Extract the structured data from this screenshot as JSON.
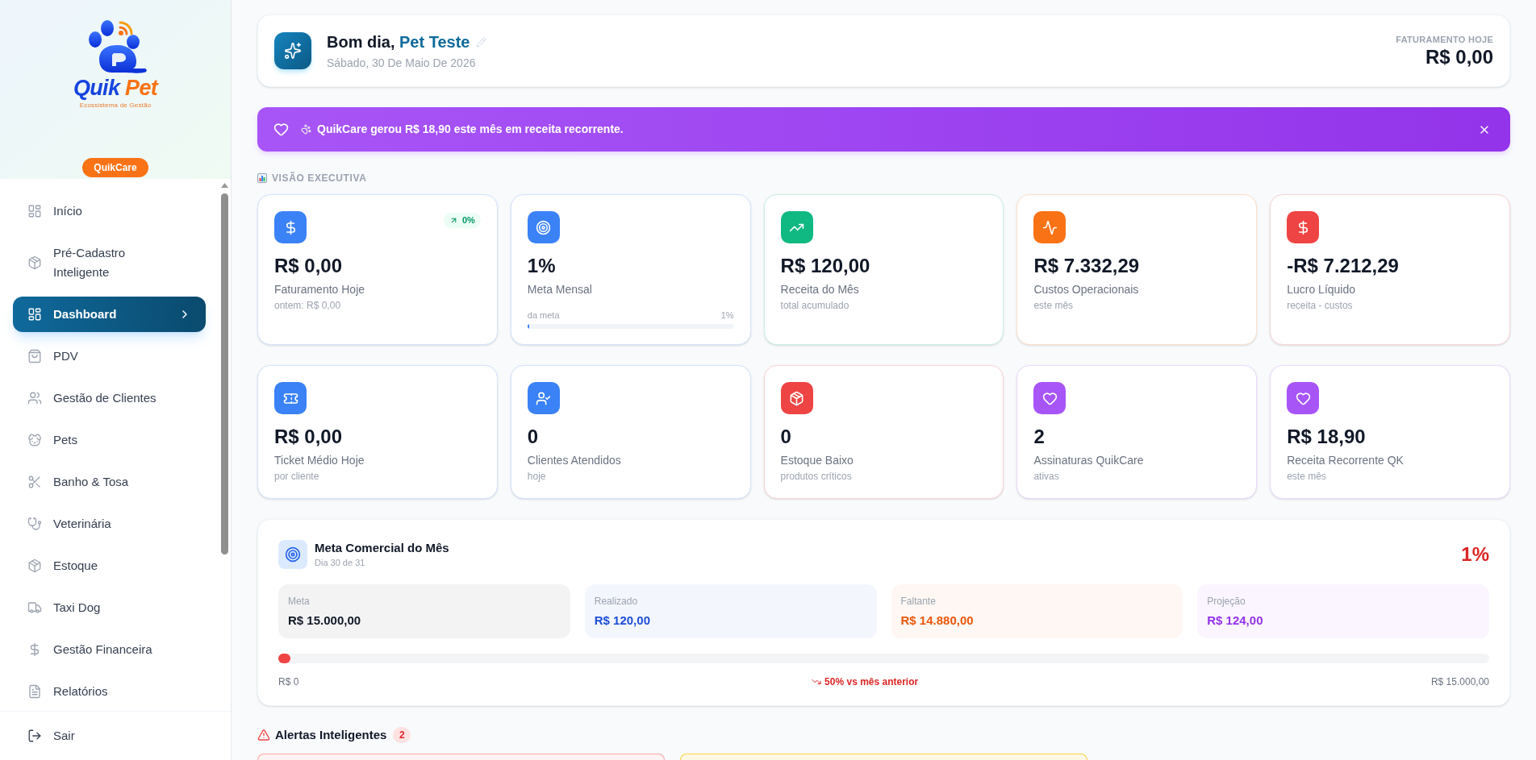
{
  "sidebar": {
    "logo": {
      "name": "Quik",
      "accent": "Pet",
      "tagline": "Ecossistema de Gestão"
    },
    "plan_badge": "QuikCare",
    "items": [
      {
        "label": "Início",
        "selected": false
      },
      {
        "label": "Pré-Cadastro Inteligente",
        "selected": false
      },
      {
        "label": "Dashboard",
        "selected": true
      },
      {
        "label": "PDV",
        "selected": false
      },
      {
        "label": "Gestão de Clientes",
        "selected": false
      },
      {
        "label": "Pets",
        "selected": false
      },
      {
        "label": "Banho & Tosa",
        "selected": false
      },
      {
        "label": "Veterinária",
        "selected": false
      },
      {
        "label": "Estoque",
        "selected": false
      },
      {
        "label": "Taxi Dog",
        "selected": false
      },
      {
        "label": "Gestão Financeira",
        "selected": false
      },
      {
        "label": "Relatórios",
        "selected": false
      }
    ],
    "logout": "Sair"
  },
  "header": {
    "greeting": "Bom dia,",
    "user_name": "Pet Teste",
    "date": "Sábado, 30 De Maio De 2026",
    "revenue_label": "FATURAMENTO HOJE",
    "revenue_value": "R$ 0,00"
  },
  "banner": {
    "message": "QuikCare gerou R$ 18,90 este mês em receita recorrente."
  },
  "executive_view": {
    "heading": "VISÃO EXECUTIVA",
    "cards": [
      {
        "value": "R$ 0,00",
        "label": "Faturamento Hoje",
        "caption": "ontem: R$ 0,00",
        "color": "#3b82f6",
        "badge": "0%"
      },
      {
        "value": "1%",
        "label": "Meta Mensal",
        "color": "#3b82f6",
        "progress": {
          "label": "da meta",
          "reading": "1%",
          "level": 0.01
        }
      },
      {
        "value": "R$ 120,00",
        "label": "Receita do Mês",
        "caption": "total acumulado",
        "color": "#10b981"
      },
      {
        "value": "R$ 7.332,29",
        "label": "Custos Operacionais",
        "caption": "este mês",
        "color": "#f97316"
      },
      {
        "value": "-R$ 7.212,29",
        "label": "Lucro Líquido",
        "caption": "receita - custos",
        "color": "#ef4444"
      },
      {
        "value": "R$ 0,00",
        "label": "Ticket Médio Hoje",
        "caption": "por cliente",
        "color": "#3b82f6"
      },
      {
        "value": "0",
        "label": "Clientes Atendidos",
        "caption": "hoje",
        "color": "#3b82f6"
      },
      {
        "value": "0",
        "label": "Estoque Baixo",
        "caption": "produtos críticos",
        "color": "#ef4444"
      },
      {
        "value": "2",
        "label": "Assinaturas QuikCare",
        "caption": "ativas",
        "color": "#a855f7"
      },
      {
        "value": "R$ 18,90",
        "label": "Receita Recorrente QK",
        "caption": "este mês",
        "color": "#a855f7"
      }
    ]
  },
  "monthly_goal": {
    "title": "Meta Comercial do Mês",
    "subtitle": "Dia 30 de 31",
    "percent": "1%",
    "boxes": [
      {
        "label": "Meta",
        "value": "R$ 15.000,00",
        "color": "#111827"
      },
      {
        "label": "Realizado",
        "value": "R$ 120,00",
        "color": "#1d4ed8"
      },
      {
        "label": "Faltante",
        "value": "R$ 14.880,00",
        "color": "#ea580c"
      },
      {
        "label": "Projeção",
        "value": "R$ 124,00",
        "color": "#9333ea"
      }
    ],
    "progress": {
      "level": 0.01
    },
    "scale_start": "R$ 0",
    "comparison": "50% vs mês anterior",
    "scale_end": "R$ 15.000,00"
  },
  "alerts": {
    "title": "Alertas Inteligentes",
    "count": "2",
    "cards": [
      {
        "color": "#fca5a5"
      },
      {
        "color": "#fcd34d"
      }
    ]
  }
}
